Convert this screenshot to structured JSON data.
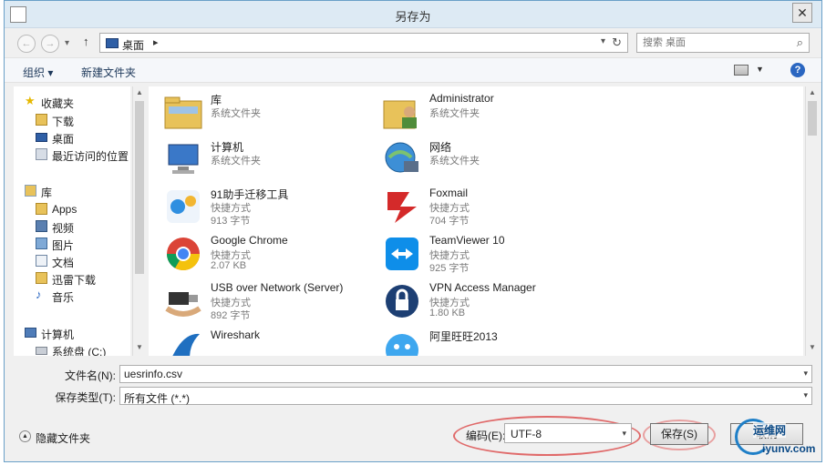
{
  "window": {
    "title": "另存为",
    "close_label": "✕"
  },
  "nav": {
    "back": "←",
    "forward": "→",
    "recent_dd": "▾",
    "up": "↑",
    "address_crumb": "桌面",
    "address_sep": "▸",
    "address_dd": "▾",
    "refresh": "↻",
    "search_placeholder": "搜索 桌面",
    "search_icon": "⌕"
  },
  "toolbar": {
    "organize_label": "组织 ▾",
    "new_folder_label": "新建文件夹",
    "view_dd": "▼",
    "help_label": "?"
  },
  "nav_pane": {
    "favorites": {
      "label": "收藏夹",
      "icon": "star-icon"
    },
    "favorites_items": [
      {
        "label": "下载",
        "icon": "download-folder-icon"
      },
      {
        "label": "桌面",
        "icon": "desktop-icon"
      },
      {
        "label": "最近访问的位置",
        "icon": "recent-places-icon"
      }
    ],
    "libraries": {
      "label": "库",
      "icon": "library-icon"
    },
    "library_items": [
      {
        "label": "Apps",
        "icon": "folder-icon"
      },
      {
        "label": "视频",
        "icon": "video-icon"
      },
      {
        "label": "图片",
        "icon": "pictures-icon"
      },
      {
        "label": "文档",
        "icon": "documents-icon"
      },
      {
        "label": "迅雷下载",
        "icon": "folder-icon"
      },
      {
        "label": "音乐",
        "icon": "music-icon"
      }
    ],
    "computer": {
      "label": "计算机",
      "icon": "computer-icon"
    },
    "computer_items": [
      {
        "label": "系统盘 (C:)",
        "icon": "drive-icon"
      }
    ],
    "scroll_up": "▲",
    "scroll_down": "▼"
  },
  "files": [
    {
      "name": "库",
      "line2": "系统文件夹",
      "line3": "",
      "icon": "library-folder-icon"
    },
    {
      "name": "Administrator",
      "line2": "系统文件夹",
      "line3": "",
      "icon": "user-folder-icon"
    },
    {
      "name": "计算机",
      "line2": "系统文件夹",
      "line3": "",
      "icon": "computer-icon"
    },
    {
      "name": "网络",
      "line2": "系统文件夹",
      "line3": "",
      "icon": "network-icon"
    },
    {
      "name": "91助手迁移工具",
      "line2": "快捷方式",
      "line3": "913 字节",
      "icon": "app-91-icon"
    },
    {
      "name": "Foxmail",
      "line2": "快捷方式",
      "line3": "704 字节",
      "icon": "foxmail-icon"
    },
    {
      "name": "Google Chrome",
      "line2": "快捷方式",
      "line3": "2.07 KB",
      "icon": "chrome-icon"
    },
    {
      "name": "TeamViewer 10",
      "line2": "快捷方式",
      "line3": "925 字节",
      "icon": "teamviewer-icon"
    },
    {
      "name": "USB over Network (Server)",
      "line2": "快捷方式",
      "line3": "892 字节",
      "icon": "usb-network-icon"
    },
    {
      "name": "VPN Access Manager",
      "line2": "快捷方式",
      "line3": "1.80 KB",
      "icon": "vpn-lock-icon"
    },
    {
      "name": "Wireshark",
      "line2": "",
      "line3": "",
      "icon": "wireshark-icon"
    },
    {
      "name": "阿里旺旺2013",
      "line2": "",
      "line3": "",
      "icon": "aliwangwang-icon"
    }
  ],
  "file_scroll": {
    "up": "▲",
    "down": "▼"
  },
  "form": {
    "filename_label": "文件名(N):",
    "filename_value": "uesrinfo.csv",
    "filetype_label": "保存类型(T):",
    "filetype_value": "所有文件 (*.*)",
    "dropdown": "▾"
  },
  "bottom": {
    "hide_folders_label": "隐藏文件夹",
    "hide_folders_icon": "▲",
    "encoding_label": "编码(E):",
    "encoding_value": "UTF-8",
    "encoding_dd": "▾",
    "save_label": "保存(S)",
    "cancel_label": "取消"
  },
  "watermark": {
    "line1": "运维网",
    "line2": "iyunv.com"
  },
  "colors": {
    "titlebar": "#ddeaf4",
    "highlight_ellipse": "#e06a6a",
    "link_blue": "#1e395b"
  }
}
